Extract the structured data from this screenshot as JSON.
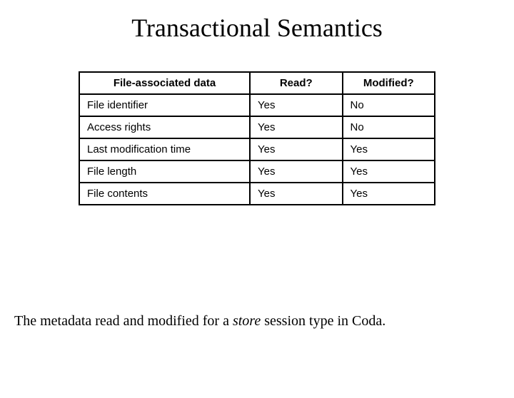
{
  "title": "Transactional Semantics",
  "table": {
    "headers": {
      "c1": "File-associated data",
      "c2": "Read?",
      "c3": "Modified?"
    },
    "rows": [
      {
        "c1": "File identifier",
        "c2": "Yes",
        "c3": "No"
      },
      {
        "c1": "Access rights",
        "c2": "Yes",
        "c3": "No"
      },
      {
        "c1": "Last modification time",
        "c2": "Yes",
        "c3": "Yes"
      },
      {
        "c1": "File length",
        "c2": "Yes",
        "c3": "Yes"
      },
      {
        "c1": "File contents",
        "c2": "Yes",
        "c3": "Yes"
      }
    ]
  },
  "caption": {
    "pre": "The metadata read and modified for a ",
    "em": "store",
    "post": " session type in Coda."
  }
}
